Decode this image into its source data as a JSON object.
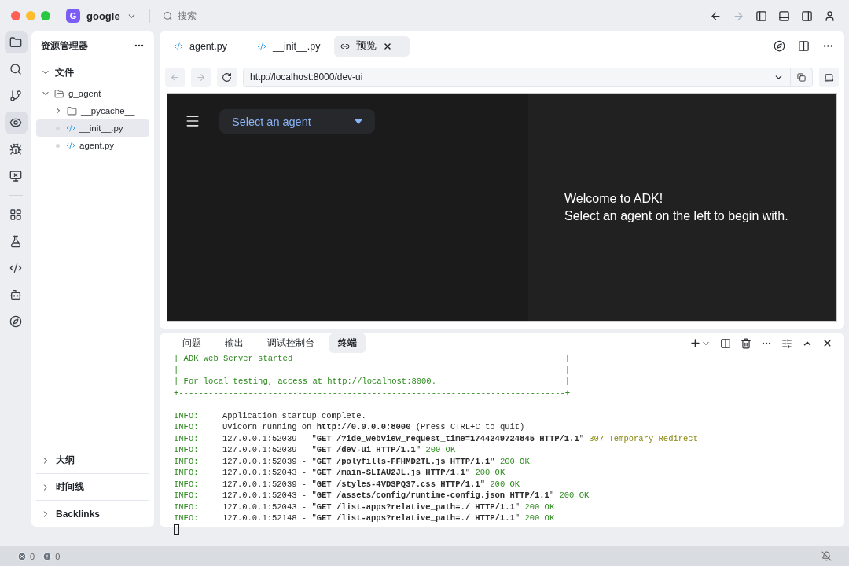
{
  "titlebar": {
    "workspace_badge": "G",
    "workspace": "google",
    "search_placeholder": "搜索"
  },
  "activity_bar": [
    {
      "selected": true
    },
    {
      "selected": false
    },
    {
      "selected": false
    },
    {
      "selected": true
    },
    {
      "selected": false
    },
    {
      "selected": false
    },
    {
      "selected": false
    },
    {
      "selected": false
    },
    {
      "selected": false
    },
    {
      "selected": false
    },
    {
      "selected": false
    }
  ],
  "sidebar": {
    "title": "资源管理器",
    "section": {
      "label": "文件",
      "expanded": true
    },
    "tree": [
      {
        "label": "g_agent",
        "kind": "folder",
        "expanded": true,
        "selected": false,
        "children": [
          {
            "label": "__pycache__",
            "kind": "folder",
            "expanded": false,
            "selected": false
          },
          {
            "label": "__init__.py",
            "kind": "python",
            "selected": true
          },
          {
            "label": "agent.py",
            "kind": "python",
            "selected": false
          }
        ]
      }
    ],
    "bottom_sections": [
      {
        "label": "大纲",
        "expanded": false
      },
      {
        "label": "时间线",
        "expanded": false
      },
      {
        "label": "Backlinks",
        "expanded": false
      }
    ]
  },
  "editor_tabs": [
    {
      "label": "agent.py",
      "kind": "python",
      "selected": false
    },
    {
      "label": "__init__.py",
      "kind": "python",
      "selected": false
    },
    {
      "label": "预览",
      "kind": "preview",
      "selected": true
    }
  ],
  "browser": {
    "back_disabled": true,
    "forward_disabled": true,
    "url": "http://localhost:8000/dev-ui",
    "page": {
      "select_placeholder": "Select an agent",
      "welcome": [
        "Welcome to ADK!",
        "Select an agent on the left to begin with."
      ]
    }
  },
  "panel_tabs": [
    {
      "label": "问题",
      "selected": false
    },
    {
      "label": "输出",
      "selected": false
    },
    {
      "label": "调试控制台",
      "selected": false
    },
    {
      "label": "终端",
      "selected": true
    }
  ],
  "terminal": {
    "banner": [
      "| ADK Web Server started                                                       |",
      "|                                                                              |",
      "| For local testing, access at http://localhost:8000.                          |",
      "+------------------------------------------------------------------------------+"
    ],
    "lines": [
      {
        "level": "INFO:",
        "parts": [
          {
            "kind": "normal",
            "text": "Application startup complete."
          }
        ]
      },
      {
        "level": "INFO:",
        "parts": [
          {
            "kind": "normal",
            "text": "Uvicorn running on "
          },
          {
            "kind": "bold",
            "text": "http://0.0.0.0:8000"
          },
          {
            "kind": "normal",
            "text": " (Press CTRL+C to quit)"
          }
        ]
      },
      {
        "level": "INFO:",
        "parts": [
          {
            "kind": "normal",
            "text": "127.0.0.1:52039 - \""
          },
          {
            "kind": "bold",
            "text": "GET /?ide_webview_request_time=1744249724845 HTTP/1.1"
          },
          {
            "kind": "normal",
            "text": "\" "
          },
          {
            "kind": "warn",
            "text": "307 Temporary Redirect"
          }
        ]
      },
      {
        "level": "INFO:",
        "parts": [
          {
            "kind": "normal",
            "text": "127.0.0.1:52039 - \""
          },
          {
            "kind": "bold",
            "text": "GET /dev-ui HTTP/1.1"
          },
          {
            "kind": "normal",
            "text": "\" "
          },
          {
            "kind": "ok",
            "text": "200 OK"
          }
        ]
      },
      {
        "level": "INFO:",
        "parts": [
          {
            "kind": "normal",
            "text": "127.0.0.1:52039 - \""
          },
          {
            "kind": "bold",
            "text": "GET /polyfills-FFHMD2TL.js HTTP/1.1"
          },
          {
            "kind": "normal",
            "text": "\" "
          },
          {
            "kind": "ok",
            "text": "200 OK"
          }
        ]
      },
      {
        "level": "INFO:",
        "parts": [
          {
            "kind": "normal",
            "text": "127.0.0.1:52043 - \""
          },
          {
            "kind": "bold",
            "text": "GET /main-SLIAU2JL.js HTTP/1.1"
          },
          {
            "kind": "normal",
            "text": "\" "
          },
          {
            "kind": "ok",
            "text": "200 OK"
          }
        ]
      },
      {
        "level": "INFO:",
        "parts": [
          {
            "kind": "normal",
            "text": "127.0.0.1:52039 - \""
          },
          {
            "kind": "bold",
            "text": "GET /styles-4VDSPQ37.css HTTP/1.1"
          },
          {
            "kind": "normal",
            "text": "\" "
          },
          {
            "kind": "ok",
            "text": "200 OK"
          }
        ]
      },
      {
        "level": "INFO:",
        "parts": [
          {
            "kind": "normal",
            "text": "127.0.0.1:52043 - \""
          },
          {
            "kind": "bold",
            "text": "GET /assets/config/runtime-config.json HTTP/1.1"
          },
          {
            "kind": "normal",
            "text": "\" "
          },
          {
            "kind": "ok",
            "text": "200 OK"
          }
        ]
      },
      {
        "level": "INFO:",
        "parts": [
          {
            "kind": "normal",
            "text": "127.0.0.1:52043 - \""
          },
          {
            "kind": "bold",
            "text": "GET /list-apps?relative_path=./ HTTP/1.1"
          },
          {
            "kind": "normal",
            "text": "\" "
          },
          {
            "kind": "ok",
            "text": "200 OK"
          }
        ]
      },
      {
        "level": "INFO:",
        "parts": [
          {
            "kind": "normal",
            "text": "127.0.0.1:52148 - \""
          },
          {
            "kind": "bold",
            "text": "GET /list-apps?relative_path=./ HTTP/1.1"
          },
          {
            "kind": "normal",
            "text": "\" "
          },
          {
            "kind": "ok",
            "text": "200 OK"
          }
        ]
      }
    ]
  },
  "status_bar": {
    "errors": "0",
    "warnings": "0"
  }
}
